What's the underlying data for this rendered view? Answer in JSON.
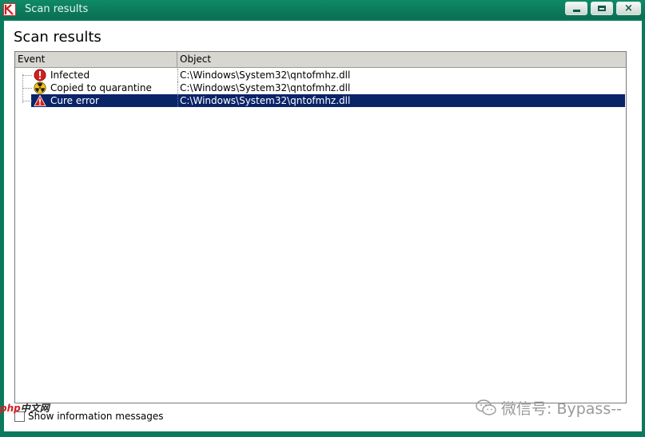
{
  "window": {
    "title": "Scan results",
    "buttons": {
      "minimize": "minimize",
      "maximize": "maximize",
      "close": "close"
    }
  },
  "page": {
    "heading": "Scan results"
  },
  "table": {
    "columns": [
      "Event",
      "Object"
    ],
    "rows": [
      {
        "event": "Infected",
        "object": "C:\\Windows\\System32\\qntofmhz.dll",
        "icon": "error-icon",
        "selected": false
      },
      {
        "event": "Copied to quarantine",
        "object": "C:\\Windows\\System32\\qntofmhz.dll",
        "icon": "radiation-icon",
        "selected": false
      },
      {
        "event": "Cure error",
        "object": "C:\\Windows\\System32\\qntofmhz.dll",
        "icon": "warning-icon",
        "selected": true
      }
    ]
  },
  "options": {
    "show_info_label": "Show information messages",
    "show_info_checked": false
  },
  "overlays": {
    "watermark": "微信号: Bypass--",
    "php_logo_red": "php",
    "php_logo_rest": "中文网"
  },
  "colors": {
    "titlebar": "#0b7a5c",
    "selection": "#0a2468"
  }
}
